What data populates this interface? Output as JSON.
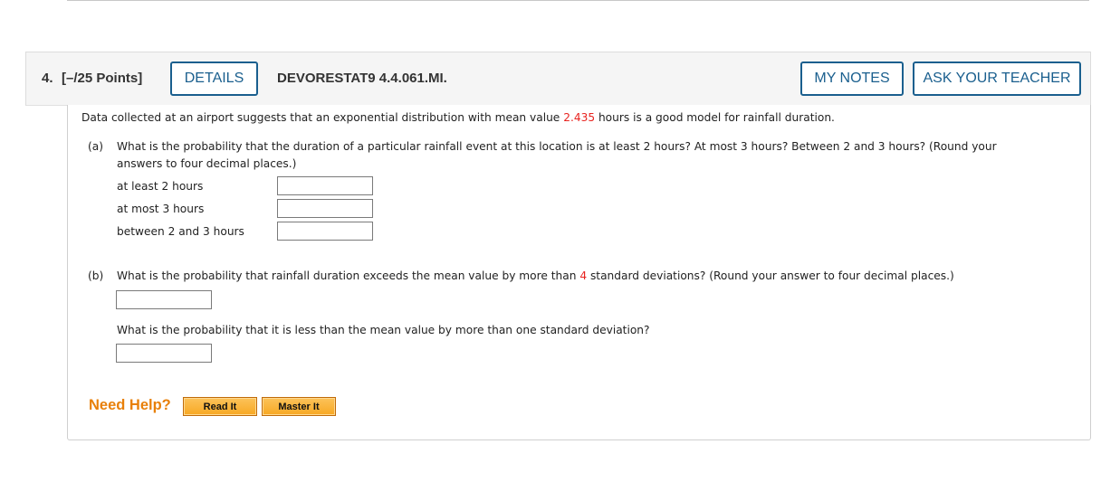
{
  "question": {
    "number": "4.",
    "points": "[–/25 Points]",
    "details_label": "DETAILS",
    "code": "DEVORESTAT9 4.4.061.MI.",
    "my_notes_label": "MY NOTES",
    "ask_teacher_label": "ASK YOUR TEACHER"
  },
  "intro": {
    "before": "Data collected at an airport suggests that an exponential distribution with mean value ",
    "mean_value": "2.435",
    "after": " hours is a good model for rainfall duration."
  },
  "part_a": {
    "label": "(a)",
    "line1": "What is the probability that the duration of a particular rainfall event at this location is at least 2 hours? At most 3 hours? Between 2 and 3 hours? (Round your",
    "line2": "answers to four decimal places.)",
    "rows": [
      {
        "label": "at least 2 hours",
        "value": ""
      },
      {
        "label": "at most 3 hours",
        "value": ""
      },
      {
        "label": "between 2 and 3 hours",
        "value": ""
      }
    ]
  },
  "part_b": {
    "label": "(b)",
    "q1_before": "What is the probability that rainfall duration exceeds the mean value by more than ",
    "q1_highlight": "4",
    "q1_after": " standard deviations? (Round your answer to four decimal places.)",
    "q1_value": "",
    "q2": "What is the probability that it is less than the mean value by more than one standard deviation?",
    "q2_value": ""
  },
  "help": {
    "label": "Need Help?",
    "read_it": "Read It",
    "master_it": "Master It"
  },
  "colors": {
    "accent_blue": "#1a5f8e",
    "highlight_red": "#e8231f",
    "help_orange": "#e8800a"
  }
}
